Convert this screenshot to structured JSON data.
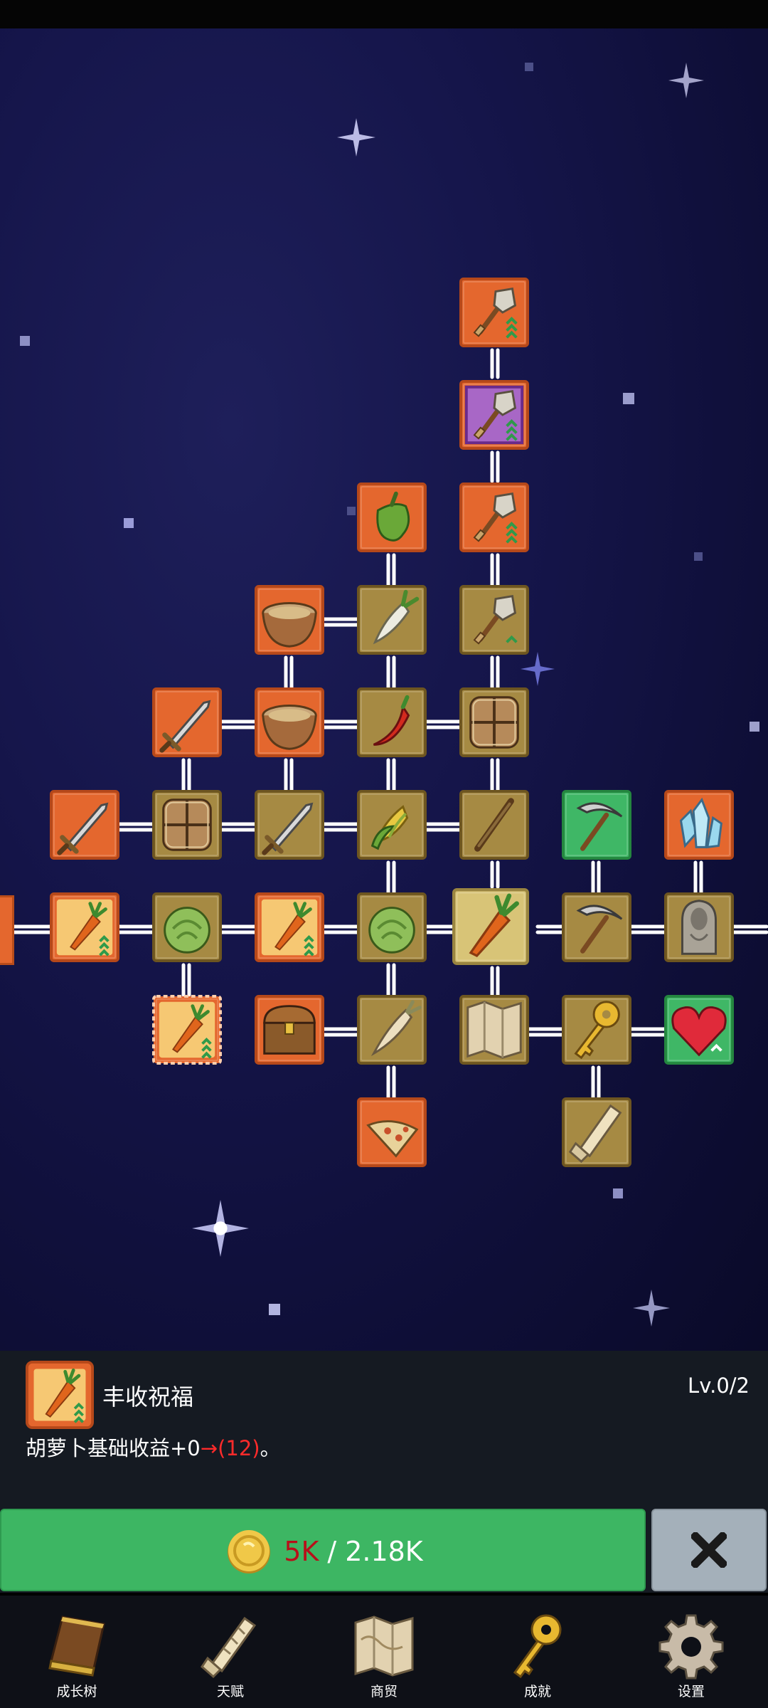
{
  "tree": {
    "nodes": [
      {
        "id": "n1",
        "icon": "shovel-upgrade-icon",
        "bg": "orange"
      },
      {
        "id": "n2",
        "icon": "shovel-upgrade-icon",
        "bg": "purple"
      },
      {
        "id": "n3",
        "icon": "bell-pepper-icon",
        "bg": "orange"
      },
      {
        "id": "n4",
        "icon": "shovel-upgrade-icon",
        "bg": "orange"
      },
      {
        "id": "n5",
        "icon": "bowl-icon",
        "bg": "orange"
      },
      {
        "id": "n6",
        "icon": "radish-icon",
        "bg": "brown"
      },
      {
        "id": "n7",
        "icon": "shovel-icon",
        "bg": "brown"
      },
      {
        "id": "n8",
        "icon": "sword-icon",
        "bg": "orange"
      },
      {
        "id": "n9",
        "icon": "bowl-icon",
        "bg": "orange"
      },
      {
        "id": "n10",
        "icon": "chili-pepper-icon",
        "bg": "brown"
      },
      {
        "id": "n11",
        "icon": "crate-icon",
        "bg": "brown"
      },
      {
        "id": "n12",
        "icon": "sword-icon",
        "bg": "orange"
      },
      {
        "id": "n13",
        "icon": "crate-icon",
        "bg": "brown"
      },
      {
        "id": "n14",
        "icon": "sword-icon",
        "bg": "brown"
      },
      {
        "id": "n15",
        "icon": "corn-icon",
        "bg": "brown"
      },
      {
        "id": "n16",
        "icon": "stick-icon",
        "bg": "brown"
      },
      {
        "id": "n17",
        "icon": "pickaxe-icon",
        "bg": "green"
      },
      {
        "id": "n18",
        "icon": "crystal-icon",
        "bg": "orange"
      },
      {
        "id": "n19",
        "icon": "carrot-upgrade-icon",
        "bg": "orange"
      },
      {
        "id": "n20",
        "icon": "cabbage-icon",
        "bg": "brown"
      },
      {
        "id": "n21",
        "icon": "carrot-upgrade-icon",
        "bg": "orange"
      },
      {
        "id": "n22",
        "icon": "cabbage-icon",
        "bg": "brown"
      },
      {
        "id": "n23",
        "icon": "carrot-icon",
        "bg": "gold"
      },
      {
        "id": "n24",
        "icon": "pickaxe-icon",
        "bg": "brown"
      },
      {
        "id": "n25",
        "icon": "statue-icon",
        "bg": "brown"
      },
      {
        "id": "n26",
        "icon": "carrot-upgrade-icon",
        "bg": "orange-selected"
      },
      {
        "id": "n27",
        "icon": "treasure-chest-icon",
        "bg": "orange"
      },
      {
        "id": "n28",
        "icon": "parsnip-icon",
        "bg": "brown"
      },
      {
        "id": "n29",
        "icon": "map-icon",
        "bg": "brown"
      },
      {
        "id": "n30",
        "icon": "key-icon",
        "bg": "brown"
      },
      {
        "id": "n31",
        "icon": "heart-icon",
        "bg": "green"
      },
      {
        "id": "n32",
        "icon": "pizza-icon",
        "bg": "orange"
      },
      {
        "id": "n33",
        "icon": "scroll-icon",
        "bg": "brown"
      }
    ]
  },
  "selected": {
    "icon": "carrot-upgrade-icon",
    "title": "丰收祝福",
    "level": "Lv.0/2",
    "desc_prefix": "胡萝卜基础收益+0",
    "desc_arrow": "→",
    "desc_value": "(12)",
    "desc_suffix": "。"
  },
  "upgrade": {
    "icon": "gold-coin-icon",
    "have": "5K",
    "separator": "/",
    "need": "2.18K"
  },
  "close": {
    "icon": "close-icon"
  },
  "nav": [
    {
      "label": "成长树",
      "icon": "book-icon"
    },
    {
      "label": "天赋",
      "icon": "scroll-icon"
    },
    {
      "label": "商贸",
      "icon": "map-icon"
    },
    {
      "label": "成就",
      "icon": "key-icon"
    },
    {
      "label": "设置",
      "icon": "gear-icon"
    }
  ],
  "colors": {
    "orange": "#e4672e",
    "brown": "#a68a43",
    "gold": "#d8c477",
    "green": "#3fb766",
    "purple": "#a867c6",
    "panel": "#151a22",
    "upgrade_button": "#3db663",
    "close_button": "#a4b0ba",
    "cost_have": "#b8101a",
    "arrow_red": "#ff2b2b"
  }
}
